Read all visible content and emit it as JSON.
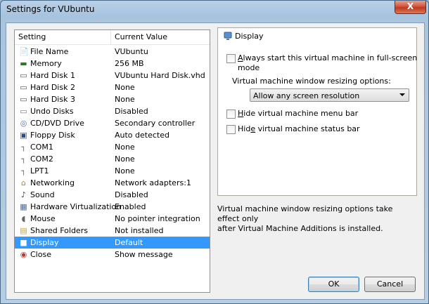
{
  "window": {
    "title": "Settings for VUbuntu",
    "close_glyph": "X"
  },
  "list": {
    "headers": {
      "setting": "Setting",
      "value": "Current Value"
    },
    "items": [
      {
        "name": "File Name",
        "value": "VUbuntu",
        "icon": "file-icon"
      },
      {
        "name": "Memory",
        "value": "256 MB",
        "icon": "memory-icon"
      },
      {
        "name": "Hard Disk 1",
        "value": "VUbuntu Hard Disk.vhd",
        "icon": "hard-disk-icon"
      },
      {
        "name": "Hard Disk 2",
        "value": "None",
        "icon": "hard-disk-icon"
      },
      {
        "name": "Hard Disk 3",
        "value": "None",
        "icon": "hard-disk-icon"
      },
      {
        "name": "Undo Disks",
        "value": "Disabled",
        "icon": "undo-disk-icon"
      },
      {
        "name": "CD/DVD Drive",
        "value": "Secondary controller",
        "icon": "cd-icon"
      },
      {
        "name": "Floppy Disk",
        "value": "Auto detected",
        "icon": "floppy-icon"
      },
      {
        "name": "COM1",
        "value": "None",
        "icon": "port-icon"
      },
      {
        "name": "COM2",
        "value": "None",
        "icon": "port-icon"
      },
      {
        "name": "LPT1",
        "value": "None",
        "icon": "port-icon"
      },
      {
        "name": "Networking",
        "value": "Network adapters:1",
        "icon": "network-icon"
      },
      {
        "name": "Sound",
        "value": "Disabled",
        "icon": "sound-icon"
      },
      {
        "name": "Hardware Virtualization",
        "value": "Enabled",
        "icon": "hardware-icon"
      },
      {
        "name": "Mouse",
        "value": "No pointer integration",
        "icon": "mouse-icon"
      },
      {
        "name": "Shared Folders",
        "value": "Not installed",
        "icon": "folder-icon"
      },
      {
        "name": "Display",
        "value": "Default",
        "icon": "display-icon"
      },
      {
        "name": "Close",
        "value": "Show message",
        "icon": "close-vm-icon"
      }
    ]
  },
  "panel": {
    "title": "Display",
    "fullscreen_prefix": "A",
    "fullscreen_rest": "lways start this virtual machine in full-screen",
    "fullscreen_line2": "mode",
    "resize_label": "Virtual machine window resizing options:",
    "resize_value": "Allow any screen resolution",
    "hide_menu_prefix": "H",
    "hide_menu_rest": "ide virtual machine menu bar",
    "hide_status_prefix": "Hid",
    "hide_status_u": "e",
    "hide_status_rest": " virtual machine status bar"
  },
  "note": {
    "line1": "Virtual machine window resizing options take effect only",
    "line2": "after Virtual Machine Additions is installed."
  },
  "buttons": {
    "ok": "OK",
    "cancel": "Cancel"
  },
  "colors": {
    "selection": "#3399ff"
  }
}
